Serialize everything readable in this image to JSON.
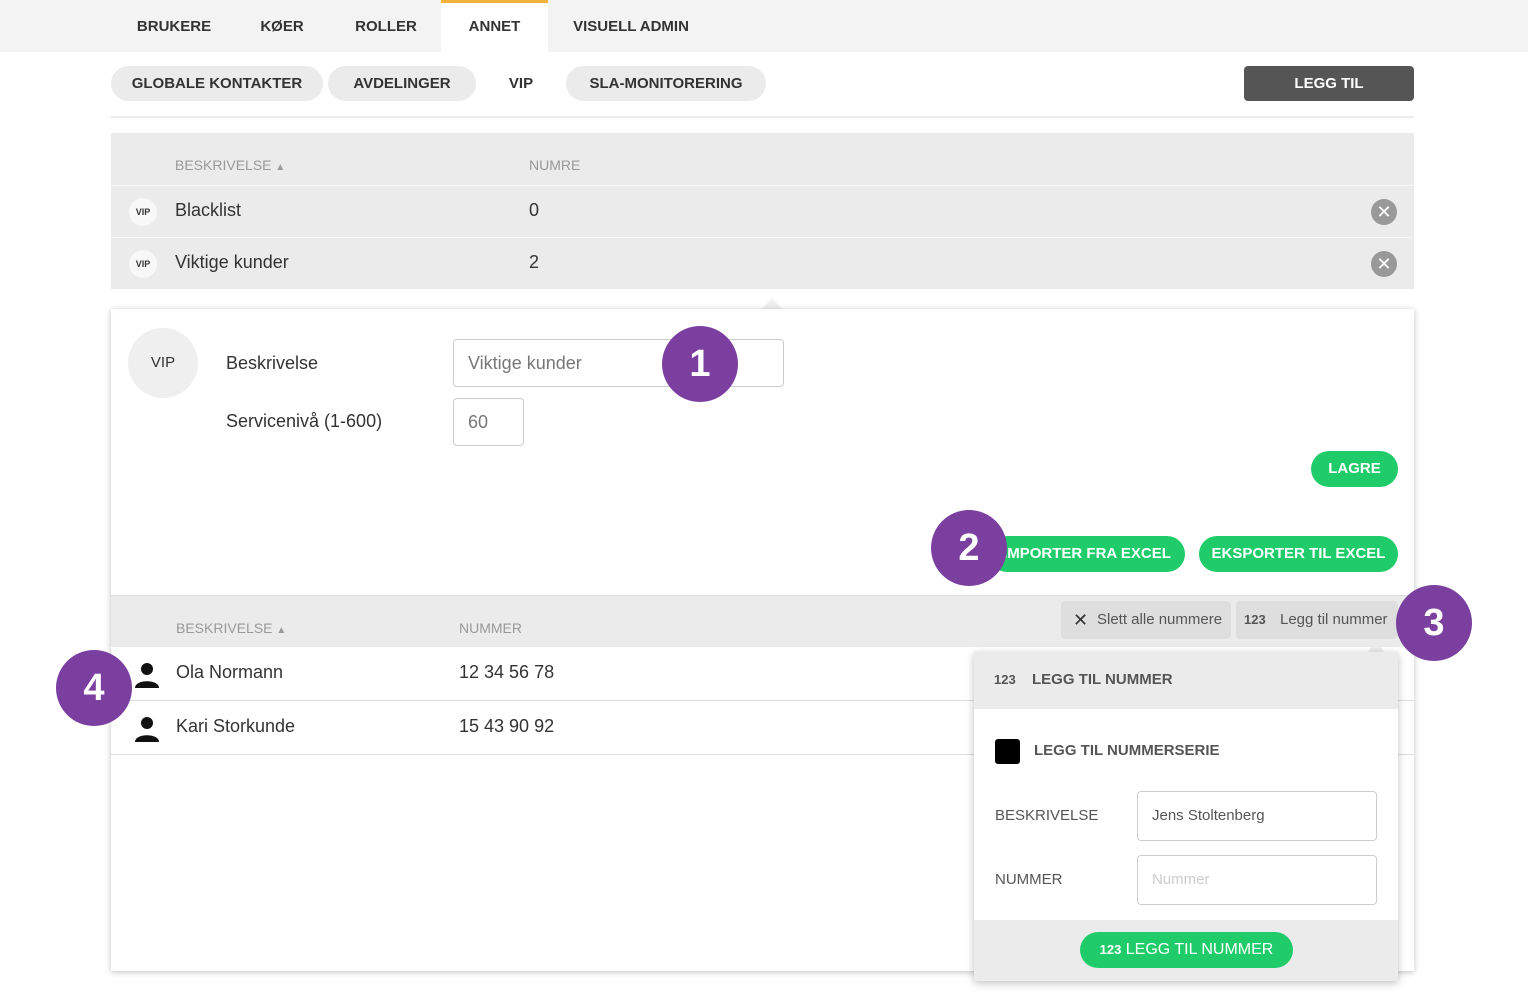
{
  "top_tabs": [
    "BRUKERE",
    "KØER",
    "ROLLER",
    "ANNET",
    "VISUELL ADMIN"
  ],
  "sub_tabs": [
    "GLOBALE KONTAKTER",
    "AVDELINGER",
    "VIP",
    "SLA-MONITORERING"
  ],
  "legg_til_label": "LEGG TIL",
  "list": {
    "col_desc": "BESKRIVELSE",
    "col_num": "NUMRE",
    "badge": "VIP",
    "rows": [
      {
        "name": "Blacklist",
        "count": "0"
      },
      {
        "name": "Viktige kunder",
        "count": "2"
      }
    ]
  },
  "detail": {
    "avatar": "VIP",
    "desc_label": "Beskrivelse",
    "desc_value": "Viktige kunder",
    "service_label": "Servicenivå (1-600)",
    "service_value": "60",
    "save": "LAGRE",
    "import": "IMPORTER FRA EXCEL",
    "export": "EKSPORTER TIL EXCEL",
    "col_desc": "BESKRIVELSE",
    "col_num": "NUMMER",
    "delete_all": "Slett alle nummere",
    "add_number": "Legg til nummer",
    "numbers": [
      {
        "name": "Ola Normann",
        "number": "12 34 56 78"
      },
      {
        "name": "Kari Storkunde",
        "number": "15 43 90 92"
      }
    ]
  },
  "popover": {
    "title": "LEGG TIL NUMMER",
    "series_label": "LEGG TIL NUMMERSERIE",
    "desc_label": "BESKRIVELSE",
    "desc_value": "Jens Stoltenberg",
    "num_label": "NUMMER",
    "num_placeholder": "Nummer",
    "submit": "LEGG TIL NUMMER",
    "num_icon": "123"
  },
  "callouts": [
    "1",
    "2",
    "3",
    "4"
  ]
}
